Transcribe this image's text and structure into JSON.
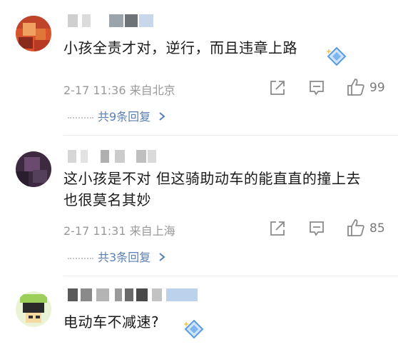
{
  "comments": [
    {
      "text": "小孩全责才对，逆行，而且违章上路",
      "time_location": "2-17 11:36  来自北京",
      "likes": "99",
      "replies_label": "共9条回复"
    },
    {
      "text_line1": "这小孩是不对 但这骑助动车的能直直的撞上去",
      "text_line2": "也很莫名其妙",
      "time_location": "2-17 11:31  来自上海",
      "likes": "85",
      "replies_label": "共3条回复"
    },
    {
      "text": "电动车不减速?"
    }
  ],
  "icons": {
    "share": "share-icon",
    "comment": "comment-icon",
    "like": "thumbs-up-icon",
    "chevron": "chevron-right-icon",
    "badge": "diamond-badge-icon"
  },
  "colors": {
    "reply_link": "#5a7fb5",
    "meta": "#999999"
  }
}
